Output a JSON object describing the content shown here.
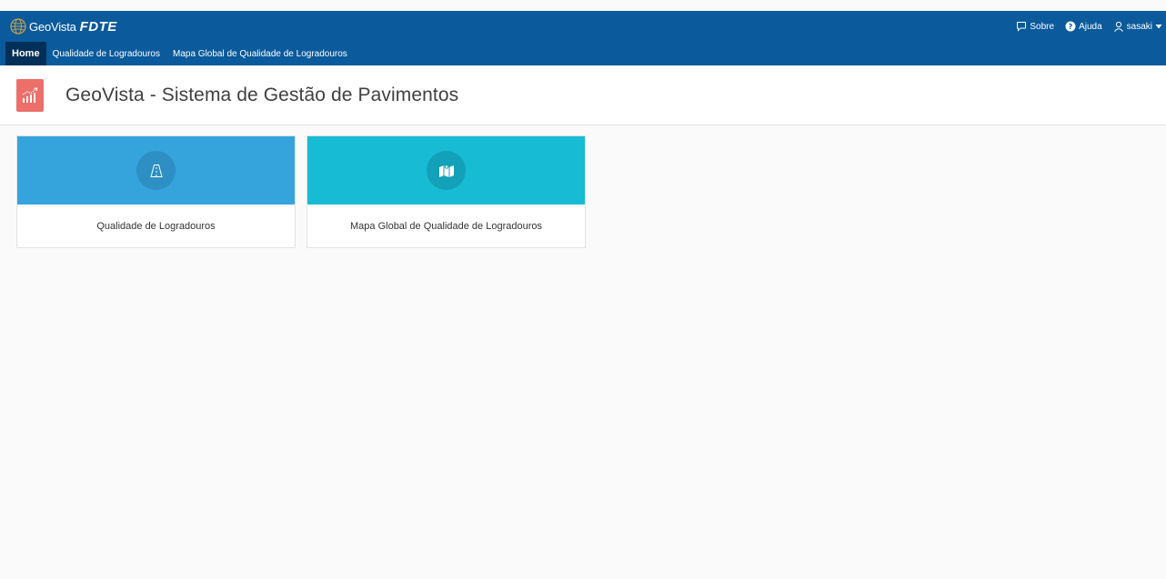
{
  "app": {
    "brand_name": "GeoVista",
    "brand_sub": "FDTE"
  },
  "topnav": {
    "sobre_label": "Sobre",
    "ajuda_label": "Ajuda",
    "user_label": "sasaki"
  },
  "menu": {
    "items": [
      {
        "label": "Home",
        "active": true
      },
      {
        "label": "Qualidade de Logradouros",
        "active": false
      },
      {
        "label": "Mapa Global de Qualidade de Logradouros",
        "active": false
      }
    ]
  },
  "header": {
    "title": "GeoVista - Sistema de Gestão de Pavimentos",
    "icon": "chart-growth-icon"
  },
  "cards": [
    {
      "label": "Qualidade de Logradouros",
      "icon": "road-icon",
      "color": "#35a4dd",
      "circle_color": "#2d8fc4"
    },
    {
      "label": "Mapa Global de Qualidade de Logradouros",
      "icon": "map-icon",
      "color": "#17bbd4",
      "circle_color": "#12a1b8"
    }
  ],
  "colors": {
    "topbar": "#0a5a9c",
    "active_menu": "#002f57",
    "header_icon": "#ec6f6a"
  }
}
